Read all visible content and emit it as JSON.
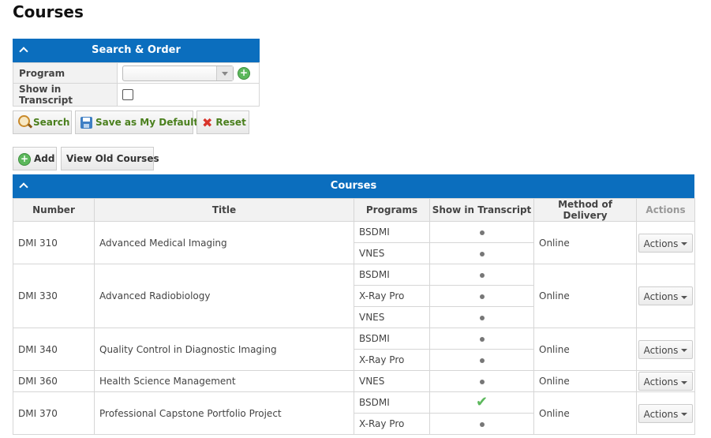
{
  "page_title": "Courses",
  "search_panel": {
    "title": "Search & Order",
    "program_label": "Program",
    "program_value": "",
    "show_in_transcript_label": "Show in Transcript",
    "show_in_transcript_checked": false
  },
  "buttons": {
    "search": "Search",
    "save_default": "Save as My Default",
    "reset": "Reset",
    "add": "Add",
    "view_old": "View Old Courses"
  },
  "courses_panel": {
    "title": "Courses",
    "columns": [
      "Number",
      "Title",
      "Programs",
      "Show in Transcript",
      "Method of Delivery",
      "Actions"
    ],
    "action_label": "Actions",
    "rows": [
      {
        "number": "DMI 310",
        "title": "Advanced Medical Imaging",
        "delivery": "Online",
        "programs": [
          {
            "name": "BSDMI",
            "show": "dot"
          },
          {
            "name": "VNES",
            "show": "dot"
          }
        ]
      },
      {
        "number": "DMI 330",
        "title": "Advanced Radiobiology",
        "delivery": "Online",
        "programs": [
          {
            "name": "BSDMI",
            "show": "dot"
          },
          {
            "name": "X-Ray Pro",
            "show": "dot"
          },
          {
            "name": "VNES",
            "show": "dot"
          }
        ]
      },
      {
        "number": "DMI 340",
        "title": "Quality Control in Diagnostic Imaging",
        "delivery": "Online",
        "programs": [
          {
            "name": "BSDMI",
            "show": "dot"
          },
          {
            "name": "X-Ray Pro",
            "show": "dot"
          }
        ]
      },
      {
        "number": "DMI 360",
        "title": "Health Science Management",
        "delivery": "Online",
        "programs": [
          {
            "name": "VNES",
            "show": "dot"
          }
        ]
      },
      {
        "number": "DMI 370",
        "title": "Professional Capstone Portfolio Project",
        "delivery": "Online",
        "programs": [
          {
            "name": "BSDMI",
            "show": "check"
          },
          {
            "name": "X-Ray Pro",
            "show": "dot"
          }
        ]
      }
    ]
  },
  "colors": {
    "header_blue": "#0b6ebe",
    "check_green": "#5cb85c"
  }
}
